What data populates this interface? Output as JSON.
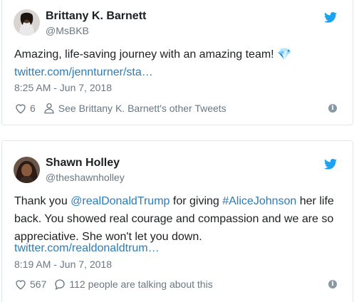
{
  "tweets": [
    {
      "author_name": "Brittany K. Barnett",
      "author_handle": "@MsBKB",
      "text": "Amazing, life-saving journey with an amazing team! 💎",
      "link": "twitter.com/jennturner/sta…",
      "timestamp": "8:25 AM - Jun 7, 2018",
      "like_count": "6",
      "secondary_action": "See Brittany K. Barnett's other Tweets",
      "avatar_icon": "person-avatar-icon",
      "brand_color": "#1da1f2"
    },
    {
      "author_name": "Shawn Holley",
      "author_handle": "@theshawnholley",
      "text_parts": {
        "a": "Thank you ",
        "mention": "@realDonaldTrump",
        "b": " for giving ",
        "hashtag": "#AliceJohnson",
        "c": " her life back. You showed real courage and compassion and we are so appreciative. She won't let you down."
      },
      "link": "twitter.com/realdonaldtrum…",
      "timestamp": "8:19 AM - Jun 7, 2018",
      "like_count": "567",
      "secondary_action": "112 people are talking about this",
      "avatar_icon": "person-avatar-icon",
      "brand_color": "#1da1f2"
    }
  ],
  "colors": {
    "link": "#2b7bb9",
    "meta": "#697882",
    "text": "#1c2022",
    "border": "#e1e8ed"
  }
}
